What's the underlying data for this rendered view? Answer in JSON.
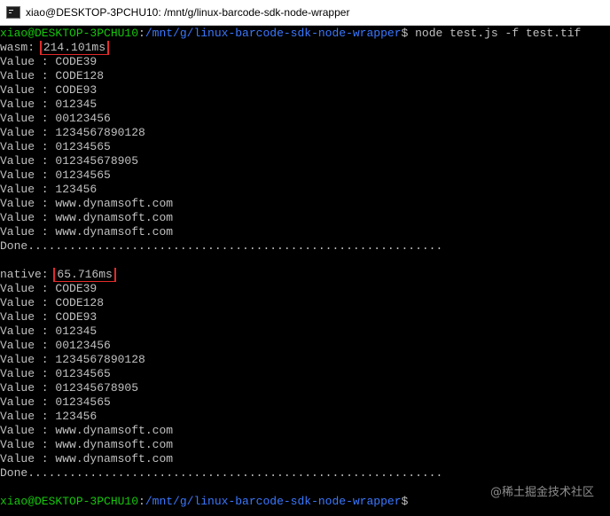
{
  "window": {
    "title": "xiao@DESKTOP-3PCHU10: /mnt/g/linux-barcode-sdk-node-wrapper",
    "icon": "terminal-icon"
  },
  "prompt": {
    "user_host": "xiao@DESKTOP-3PCHU10",
    "separator": ":",
    "path": "/mnt/g/linux-barcode-sdk-node-wrapper",
    "symbol": "$",
    "command": " node test.js -f test.tif"
  },
  "runs": [
    {
      "label": "wasm: ",
      "time": "214.101ms",
      "values": [
        "CODE39",
        "CODE128",
        "CODE93",
        "012345",
        "00123456",
        "1234567890128",
        "01234565",
        "012345678905",
        "01234565",
        "123456",
        "www.dynamsoft.com",
        "www.dynamsoft.com",
        "www.dynamsoft.com"
      ],
      "done": "Done............................................................"
    },
    {
      "label": "native: ",
      "time": "65.716ms",
      "values": [
        "CODE39",
        "CODE128",
        "CODE93",
        "012345",
        "00123456",
        "1234567890128",
        "01234565",
        "012345678905",
        "01234565",
        "123456",
        "www.dynamsoft.com",
        "www.dynamsoft.com",
        "www.dynamsoft.com"
      ],
      "done": "Done............................................................"
    }
  ],
  "value_prefix": "Value : ",
  "watermark": "@稀土掘金技术社区",
  "colors": {
    "prompt_user": "#16c60c",
    "prompt_path": "#3b78ff",
    "highlight_box": "#e12b2b",
    "text": "#c0c0c0"
  }
}
